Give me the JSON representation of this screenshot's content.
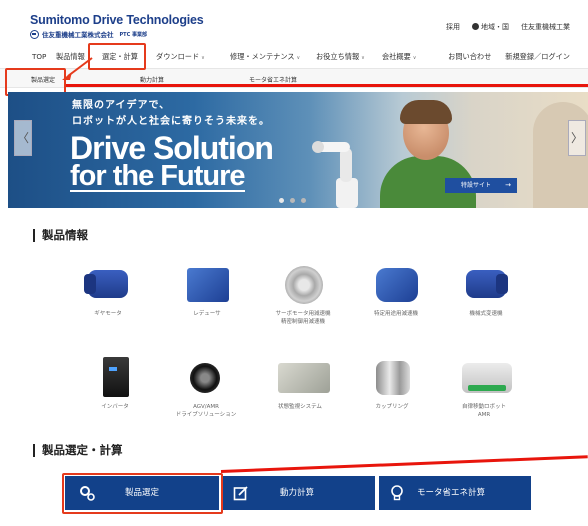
{
  "header": {
    "logo_main": "Sumitomo Drive Technologies",
    "logo_company": "住友重機械工業株式会社",
    "logo_division": "PTC 事業部",
    "top_links": [
      "採用",
      "地域・国",
      "住友重機械工業"
    ]
  },
  "nav": {
    "items": [
      {
        "label": "TOP",
        "chevron": false
      },
      {
        "label": "製品情報",
        "chevron": false
      },
      {
        "label": "選定・計算",
        "chevron": false
      },
      {
        "label": "ダウンロード",
        "chevron": true
      },
      {
        "label": "修理・メンテナンス",
        "chevron": true
      },
      {
        "label": "お役立ち情報",
        "chevron": true
      },
      {
        "label": "会社概要",
        "chevron": true
      }
    ],
    "right": [
      "お問い合わせ",
      "新規登録／ログイン"
    ],
    "chevron_char": "∨"
  },
  "subnav": [
    "製品選定",
    "動力計算",
    "モータ省エネ計算"
  ],
  "banner": {
    "line1": "無限のアイデアで、",
    "line2": "ロボットが人と社会に寄りそう未来を。",
    "title1": "Drive Solution",
    "title2": "for the Future",
    "button": "特設サイト",
    "prev": "〈",
    "next": "〉"
  },
  "products_section": {
    "title": "製品情報",
    "items": [
      {
        "label": "ギヤモータ",
        "icon": "gearmotor"
      },
      {
        "label": "レデューサ",
        "icon": "reducer"
      },
      {
        "label": "サーボモータ用減速機\n精密制御用減速機",
        "icon": "servo-reducer"
      },
      {
        "label": "特定用途用減速機",
        "icon": "special-reducer"
      },
      {
        "label": "機械式変速機",
        "icon": "mechanical-transmission"
      },
      {
        "label": "インバータ",
        "icon": "inverter"
      },
      {
        "label": "AGV/AMR\nドライブソリューション",
        "icon": "agv-drive"
      },
      {
        "label": "状態監視システム",
        "icon": "monitoring-system"
      },
      {
        "label": "カップリング",
        "icon": "coupling"
      },
      {
        "label": "自律移動ロボット\nAMR",
        "icon": "amr-robot"
      }
    ]
  },
  "selection_section": {
    "title": "製品選定・計算",
    "buttons": [
      {
        "label": "製品選定",
        "icon": "gears-icon"
      },
      {
        "label": "動力計算",
        "icon": "edit-icon"
      },
      {
        "label": "モータ省エネ計算",
        "icon": "bulb-icon"
      }
    ]
  },
  "colors": {
    "brand": "#1d3f8a",
    "button_bg": "#12418a",
    "highlight": "#e53a1c"
  }
}
